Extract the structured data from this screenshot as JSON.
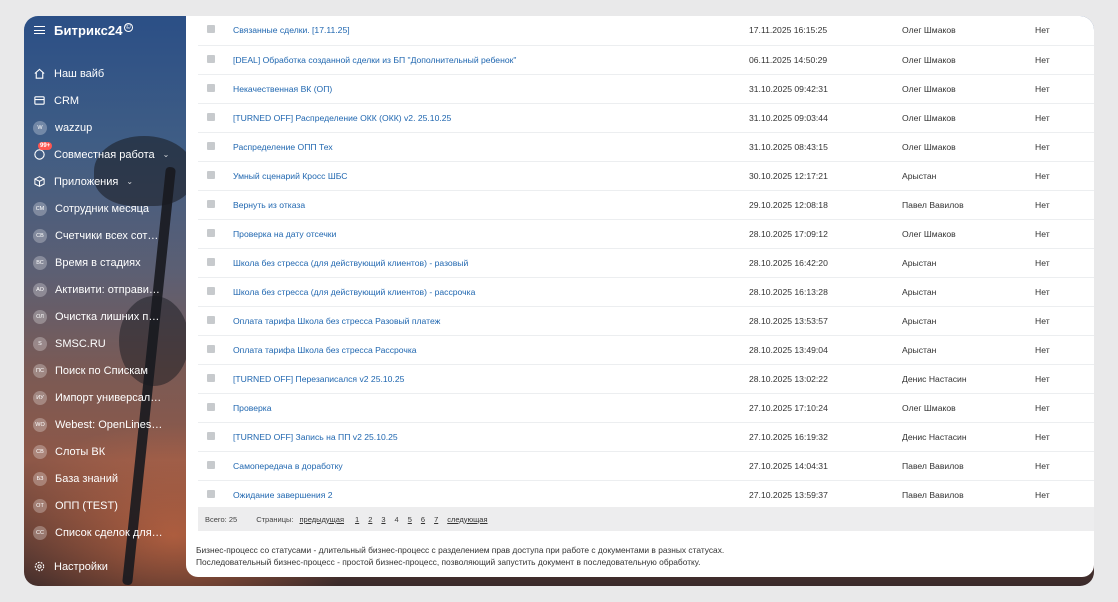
{
  "app": {
    "logo": "Битрикс24",
    "logo_mark": "©"
  },
  "sidebar": {
    "items": [
      {
        "label": "Наш вайб",
        "icon": "home-icon"
      },
      {
        "label": "CRM",
        "icon": "crm-icon"
      },
      {
        "label": "wazzup",
        "abbr": "W"
      },
      {
        "label": "Совместная работа",
        "icon": "collab-icon",
        "badge": "99+",
        "chevron": "⌄"
      },
      {
        "label": "Приложения",
        "icon": "cube-icon",
        "chevron": "⌄"
      },
      {
        "label": "Сотрудник месяца",
        "abbr": "СМ"
      },
      {
        "label": "Счетчики всех сотруд...",
        "abbr": "СВ"
      },
      {
        "label": "Время в стадиях",
        "abbr": "ВС"
      },
      {
        "label": "Активити: отправить в...",
        "abbr": "АО"
      },
      {
        "label": "Очистка лишних поле...",
        "abbr": "ОЛ"
      },
      {
        "label": "SMSC.RU",
        "abbr": "S"
      },
      {
        "label": "Поиск по Спискам",
        "abbr": "ПС"
      },
      {
        "label": "Импорт универсальн...",
        "abbr": "ИУ"
      },
      {
        "label": "Webest: OpenLines Act...",
        "abbr": "WO"
      },
      {
        "label": "Слоты ВК",
        "abbr": "СВ"
      },
      {
        "label": "База знаний",
        "abbr": "БЗ"
      },
      {
        "label": "ОПП (TEST)",
        "abbr": "ОТ"
      },
      {
        "label": "Список сделок для об...",
        "abbr": "СС"
      }
    ],
    "settings_label": "Настройки"
  },
  "table": {
    "rows": [
      {
        "name": "Связанные сделки. [17.11.25]",
        "date": "17.11.2025 16:15:25",
        "user": "Олег Шмаков",
        "flag": "Нет"
      },
      {
        "name": "[DEAL] Обработка созданной сделки из БП \"Дополнительный ребенок\"",
        "date": "06.11.2025 14:50:29",
        "user": "Олег Шмаков",
        "flag": "Нет"
      },
      {
        "name": "Некачественная ВК (ОП)",
        "date": "31.10.2025 09:42:31",
        "user": "Олег Шмаков",
        "flag": "Нет"
      },
      {
        "name": "[TURNED OFF] Распределение ОКК (ОКК) v2. 25.10.25",
        "date": "31.10.2025 09:03:44",
        "user": "Олег Шмаков",
        "flag": "Нет"
      },
      {
        "name": "Распределение ОПП Тех",
        "date": "31.10.2025 08:43:15",
        "user": "Олег Шмаков",
        "flag": "Нет"
      },
      {
        "name": "Умный сценарий Кросс ШБС",
        "date": "30.10.2025 12:17:21",
        "user": "Арыстан",
        "flag": "Нет"
      },
      {
        "name": "Вернуть из отказа",
        "date": "29.10.2025 12:08:18",
        "user": "Павел Вавилов",
        "flag": "Нет"
      },
      {
        "name": "Проверка на дату отсечки",
        "date": "28.10.2025 17:09:12",
        "user": "Олег Шмаков",
        "flag": "Нет"
      },
      {
        "name": "Школа без стресса (для действующий клиентов) - разовый",
        "date": "28.10.2025 16:42:20",
        "user": "Арыстан",
        "flag": "Нет"
      },
      {
        "name": "Школа без стресса (для действующий клиентов) - рассрочка",
        "date": "28.10.2025 16:13:28",
        "user": "Арыстан",
        "flag": "Нет"
      },
      {
        "name": "Оплата тарифа Школа без стресса Разовый платеж",
        "date": "28.10.2025 13:53:57",
        "user": "Арыстан",
        "flag": "Нет"
      },
      {
        "name": "Оплата тарифа Школа без стресса Рассрочка",
        "date": "28.10.2025 13:49:04",
        "user": "Арыстан",
        "flag": "Нет"
      },
      {
        "name": "[TURNED OFF] Перезаписался v2 25.10.25",
        "date": "28.10.2025 13:02:22",
        "user": "Денис Настасин",
        "flag": "Нет"
      },
      {
        "name": "Проверка",
        "date": "27.10.2025 17:10:24",
        "user": "Олег Шмаков",
        "flag": "Нет"
      },
      {
        "name": "[TURNED OFF] Запись на ПП v2 25.10.25",
        "date": "27.10.2025 16:19:32",
        "user": "Денис Настасин",
        "flag": "Нет"
      },
      {
        "name": "Самопередача в доработку",
        "date": "27.10.2025 14:04:31",
        "user": "Павел Вавилов",
        "flag": "Нет"
      },
      {
        "name": "Ожидание завершения 2",
        "date": "27.10.2025 13:59:37",
        "user": "Павел Вавилов",
        "flag": "Нет"
      }
    ]
  },
  "pager": {
    "total": "Всего: 25",
    "pages_label": "Страницы:",
    "prev": "предыдущая",
    "pages": [
      "1",
      "2",
      "3",
      "4",
      "5",
      "6",
      "7"
    ],
    "current": "4",
    "next": "следующая"
  },
  "description": {
    "line1": "Бизнес-процесс со статусами - длительный бизнес-процесс с разделением прав доступа при работе с документами в разных статусах.",
    "line2": "Последовательный бизнес-процесс - простой бизнес-процесс, позволяющий запустить документ в последовательную обработку."
  }
}
